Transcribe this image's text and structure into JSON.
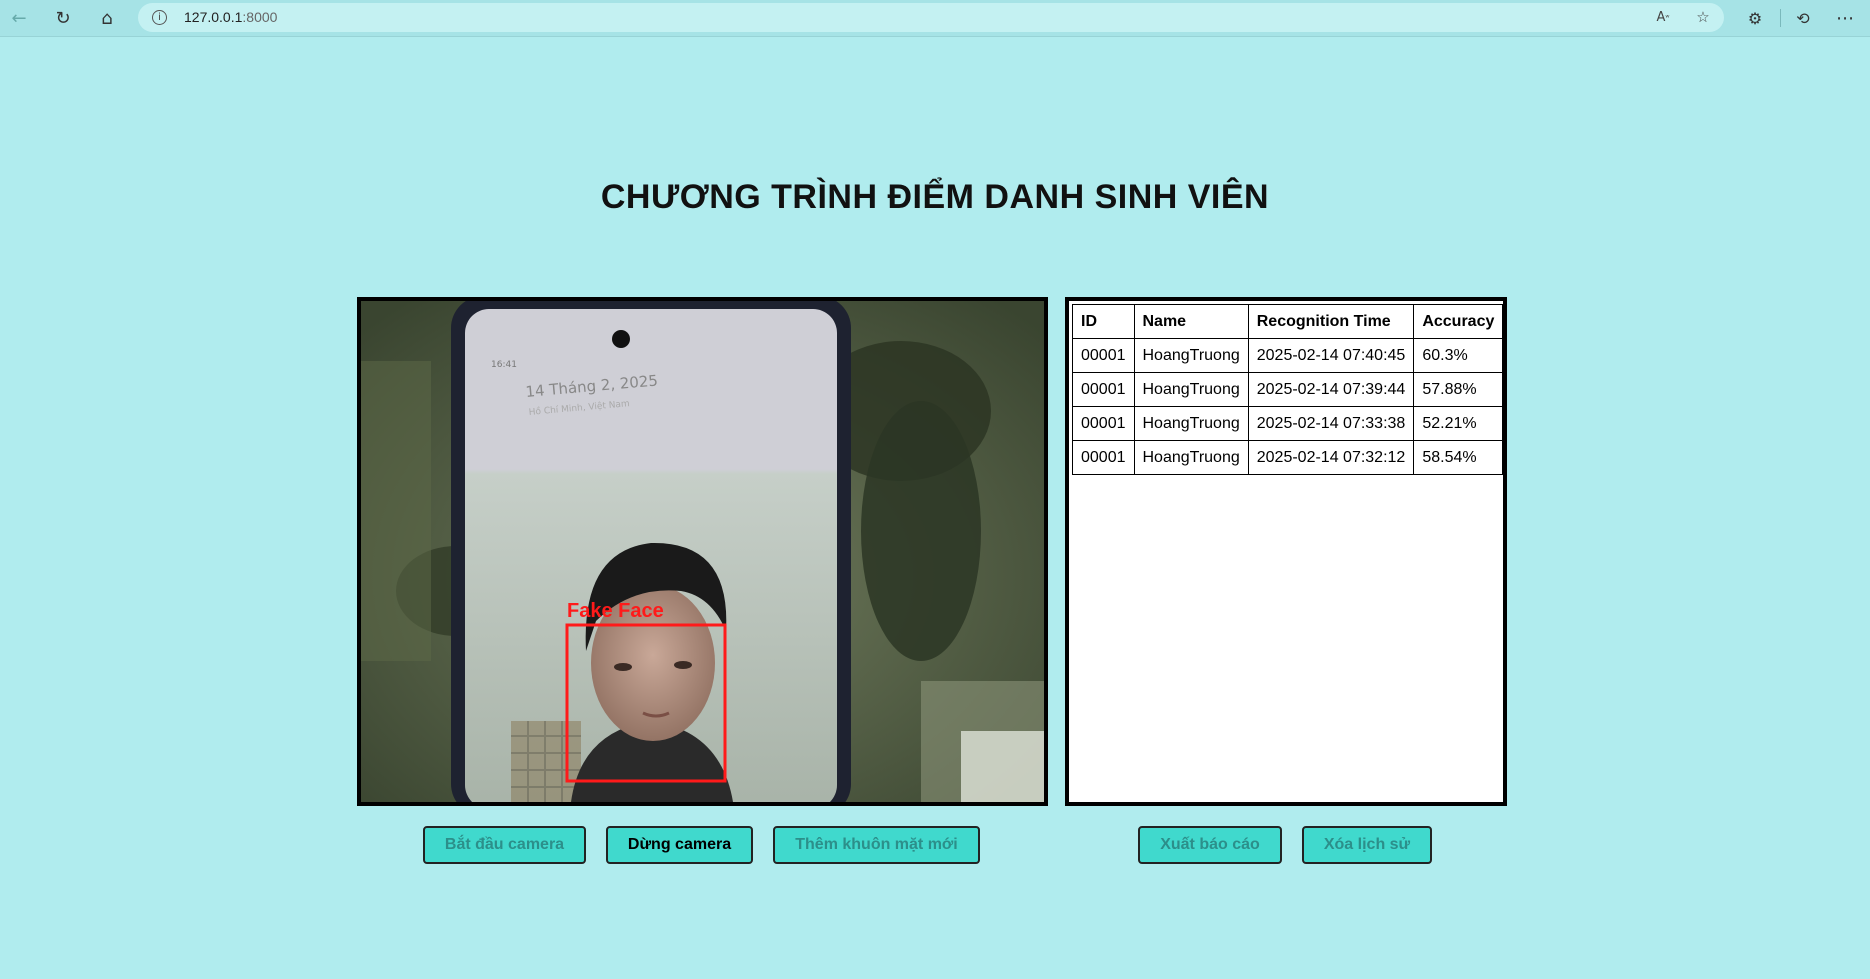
{
  "browser": {
    "url_host": "127.0.0.1",
    "url_port": ":8000",
    "icons": [
      "back-icon",
      "refresh-icon",
      "home-icon",
      "info-icon",
      "read-aloud-icon",
      "favorite-star-icon",
      "extensions-icon",
      "history-icon",
      "more-icon"
    ]
  },
  "page": {
    "title": "CHƯƠNG TRÌNH ĐIỂM DANH SINH VIÊN"
  },
  "camera": {
    "phone_time": "16:41",
    "phone_date": "14 Tháng 2, 2025",
    "phone_location": "Hồ Chí Minh, Việt Nam",
    "detection_label": "Fake Face",
    "detection_color": "#ff1a1a"
  },
  "table": {
    "headers": [
      "ID",
      "Name",
      "Recognition Time",
      "Accuracy"
    ],
    "rows": [
      [
        "00001",
        "HoangTruong",
        "2025-02-14 07:40:45",
        "60.3%"
      ],
      [
        "00001",
        "HoangTruong",
        "2025-02-14 07:39:44",
        "57.88%"
      ],
      [
        "00001",
        "HoangTruong",
        "2025-02-14 07:33:38",
        "52.21%"
      ],
      [
        "00001",
        "HoangTruong",
        "2025-02-14 07:32:12",
        "58.54%"
      ]
    ]
  },
  "buttons": {
    "start_camera": "Bắt đầu camera",
    "stop_camera": "Dừng camera",
    "add_face": "Thêm khuôn mặt mới",
    "export_report": "Xuất báo cáo",
    "clear_history": "Xóa lịch sử"
  },
  "colors": {
    "background": "#b0ecee",
    "button": "#40d9cd",
    "detection_box": "#ff1a1a"
  }
}
